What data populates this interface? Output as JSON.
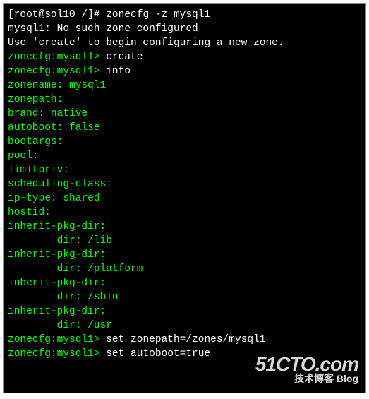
{
  "prompts": {
    "root": "[root@sol10 /]# ",
    "zonecfg": "zonecfg:mysql1> "
  },
  "commands": {
    "cmd1": "zonecfg -z mysql1",
    "cmd2": "create",
    "cmd3": "info",
    "cmd4": "set zonepath=/zones/mysql1",
    "cmd5": "set autoboot=true"
  },
  "messages": {
    "no_zone": "mysql1: No such zone configured",
    "use_create": "Use 'create' to begin configuring a new zone."
  },
  "info": {
    "zonename": "zonename: mysql1",
    "zonepath": "zonepath:",
    "brand": "brand: native",
    "autoboot": "autoboot: false",
    "bootargs": "bootargs:",
    "pool": "pool:",
    "limitpriv": "limitpriv:",
    "scheduling_class": "scheduling-class:",
    "ip_type": "ip-type: shared",
    "hostid": "hostid:",
    "inherit1": "inherit-pkg-dir:",
    "dir1": "        dir: /lib",
    "inherit2": "inherit-pkg-dir:",
    "dir2": "        dir: /platform",
    "inherit3": "inherit-pkg-dir:",
    "dir3": "        dir: /sbin",
    "inherit4": "inherit-pkg-dir:",
    "dir4": "        dir: /usr"
  },
  "watermark": {
    "main": "51CTO.com",
    "sub": "技术博客  Blog"
  }
}
